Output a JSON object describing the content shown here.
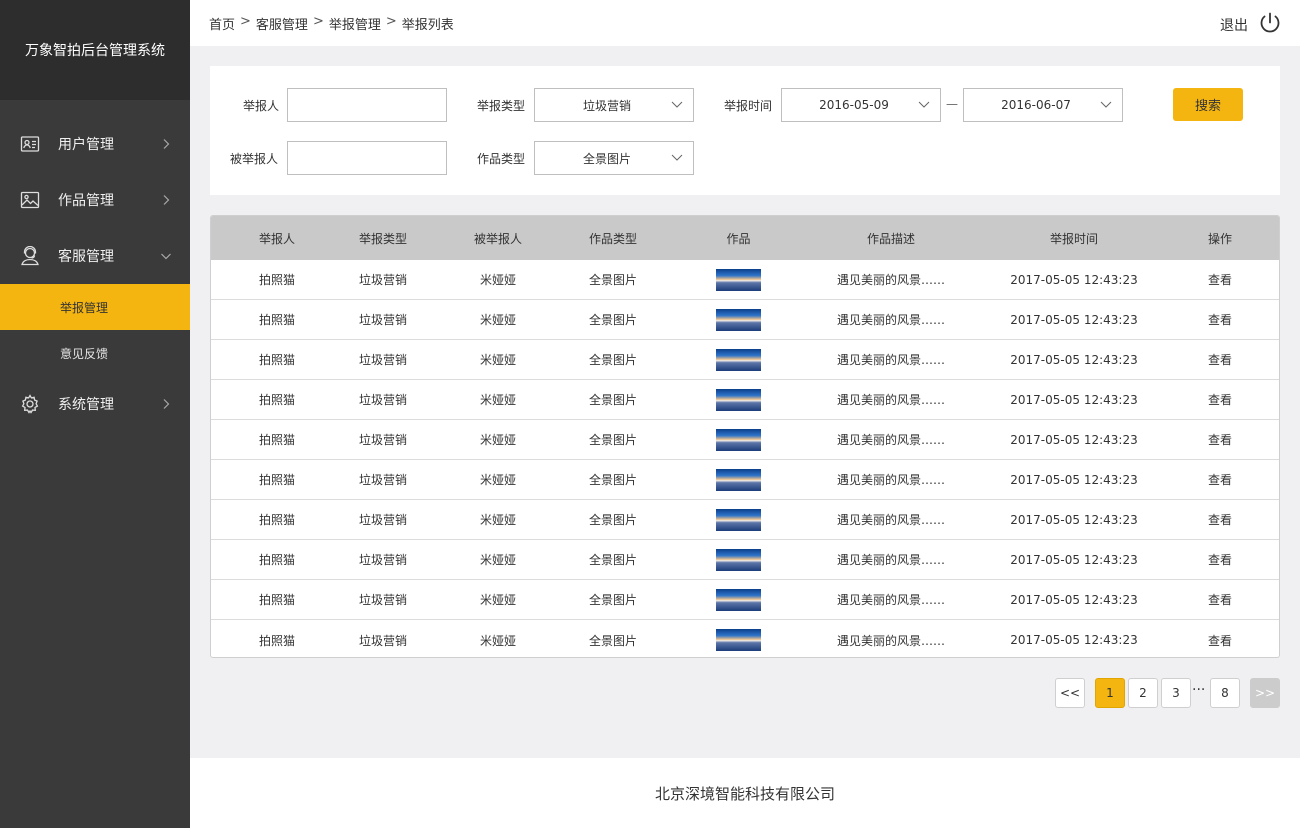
{
  "app": {
    "title": "万象智拍后台管理系统"
  },
  "sidebar": {
    "items": [
      {
        "label": "用户管理",
        "icon": "id-card-icon",
        "expanded": false
      },
      {
        "label": "作品管理",
        "icon": "image-icon",
        "expanded": false
      },
      {
        "label": "客服管理",
        "icon": "headset-icon",
        "expanded": true,
        "children": [
          {
            "label": "举报管理",
            "active": true
          },
          {
            "label": "意见反馈",
            "active": false
          }
        ]
      },
      {
        "label": "系统管理",
        "icon": "gear-icon",
        "expanded": false
      }
    ]
  },
  "header": {
    "breadcrumb": [
      "首页",
      "客服管理",
      "举报管理",
      "举报列表"
    ],
    "breadcrumb_sep": ">",
    "logout_label": "退出"
  },
  "filters": {
    "reporter_label": "举报人",
    "reporter_value": "",
    "reported_label": "被举报人",
    "reported_value": "",
    "report_type_label": "举报类型",
    "report_type_value": "垃圾营销",
    "work_type_label": "作品类型",
    "work_type_value": "全景图片",
    "report_time_label": "举报时间",
    "date_from": "2016-05-09",
    "date_to": "2016-06-07",
    "date_separator": "—",
    "search_label": "搜索"
  },
  "table": {
    "headers": [
      "举报人",
      "举报类型",
      "被举报人",
      "作品类型",
      "作品",
      "作品描述",
      "举报时间",
      "操作"
    ],
    "rows": [
      {
        "reporter": "拍照猫",
        "type": "垃圾营销",
        "reported": "米娅娅",
        "work_type": "全景图片",
        "desc": "遇见美丽的风景……",
        "time": "2017-05-05  12:43:23",
        "action": "查看"
      },
      {
        "reporter": "拍照猫",
        "type": "垃圾营销",
        "reported": "米娅娅",
        "work_type": "全景图片",
        "desc": "遇见美丽的风景……",
        "time": "2017-05-05  12:43:23",
        "action": "查看"
      },
      {
        "reporter": "拍照猫",
        "type": "垃圾营销",
        "reported": "米娅娅",
        "work_type": "全景图片",
        "desc": "遇见美丽的风景……",
        "time": "2017-05-05  12:43:23",
        "action": "查看"
      },
      {
        "reporter": "拍照猫",
        "type": "垃圾营销",
        "reported": "米娅娅",
        "work_type": "全景图片",
        "desc": "遇见美丽的风景……",
        "time": "2017-05-05  12:43:23",
        "action": "查看"
      },
      {
        "reporter": "拍照猫",
        "type": "垃圾营销",
        "reported": "米娅娅",
        "work_type": "全景图片",
        "desc": "遇见美丽的风景……",
        "time": "2017-05-05  12:43:23",
        "action": "查看"
      },
      {
        "reporter": "拍照猫",
        "type": "垃圾营销",
        "reported": "米娅娅",
        "work_type": "全景图片",
        "desc": "遇见美丽的风景……",
        "time": "2017-05-05  12:43:23",
        "action": "查看"
      },
      {
        "reporter": "拍照猫",
        "type": "垃圾营销",
        "reported": "米娅娅",
        "work_type": "全景图片",
        "desc": "遇见美丽的风景……",
        "time": "2017-05-05  12:43:23",
        "action": "查看"
      },
      {
        "reporter": "拍照猫",
        "type": "垃圾营销",
        "reported": "米娅娅",
        "work_type": "全景图片",
        "desc": "遇见美丽的风景……",
        "time": "2017-05-05  12:43:23",
        "action": "查看"
      },
      {
        "reporter": "拍照猫",
        "type": "垃圾营销",
        "reported": "米娅娅",
        "work_type": "全景图片",
        "desc": "遇见美丽的风景……",
        "time": "2017-05-05  12:43:23",
        "action": "查看"
      },
      {
        "reporter": "拍照猫",
        "type": "垃圾营销",
        "reported": "米娅娅",
        "work_type": "全景图片",
        "desc": "遇见美丽的风景……",
        "time": "2017-05-05  12:43:23",
        "action": "查看"
      }
    ]
  },
  "pagination": {
    "prev": "<<",
    "pages": [
      "1",
      "2",
      "3"
    ],
    "ellipsis": "···",
    "last": "8",
    "next": ">>",
    "current": "1"
  },
  "footer": {
    "company": "北京深境智能科技有限公司"
  },
  "colors": {
    "accent": "#f4b511",
    "sidebar": "#3a3a3a",
    "sidebar_brand": "#2d2d2d",
    "table_header": "#c9c9c9"
  }
}
